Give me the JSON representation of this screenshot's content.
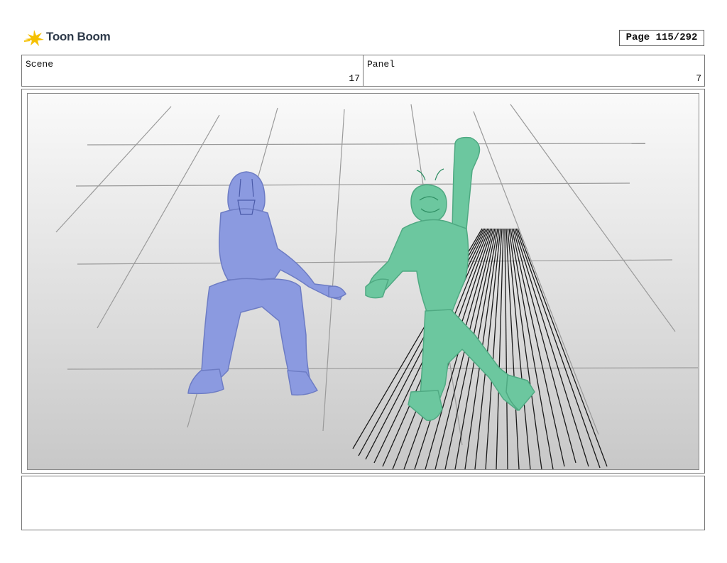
{
  "header": {
    "logo_text": "Toon Boom",
    "page_label": "Page 115/292"
  },
  "scene": {
    "label": "Scene",
    "value": "17"
  },
  "panel": {
    "label": "Panel",
    "value": "7"
  },
  "colors": {
    "figure_left": "#8b9ae0",
    "figure_right": "#6cc79f",
    "logo_star": "#f5c000",
    "background_top": "#fafafa",
    "background_bottom": "#c8c8c8"
  },
  "notes": {
    "text": ""
  }
}
